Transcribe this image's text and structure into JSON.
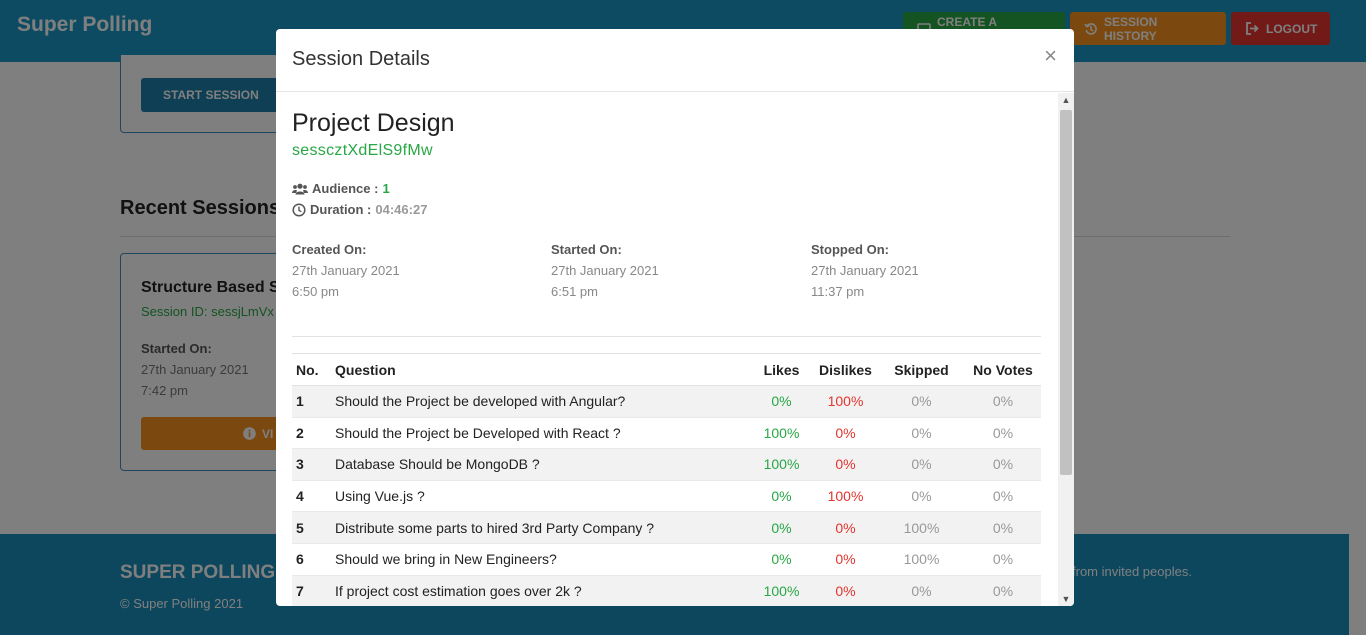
{
  "navbar": {
    "brand": "Super Polling",
    "create_label": "CREATE A SESSION",
    "history_label": "SESSION HISTORY",
    "logout_label": "LOGOUT"
  },
  "page": {
    "start_session_label": "START SESSION",
    "recent_sessions_title": "Recent Sessions",
    "session_card": {
      "title": "Structure Based S",
      "session_id": "Session ID: sessjLmVx",
      "started_label": "Started On:",
      "started_date": "27th January 2021",
      "started_time": "7:42 pm",
      "view_label": "VI"
    }
  },
  "footer": {
    "brand": "SUPER POLLING",
    "copyright": "© Super Polling 2021",
    "tagline": "from invited peoples."
  },
  "modal": {
    "title": "Session Details",
    "close": "×",
    "project_title": "Project Design",
    "session_code": "sesscztXdElS9fMw",
    "audience_label": "Audience :",
    "audience_value": "1",
    "duration_label": "Duration :",
    "duration_value": "04:46:27",
    "created": {
      "label": "Created On:",
      "date": "27th January 2021",
      "time": "6:50 pm"
    },
    "started": {
      "label": "Started On:",
      "date": "27th January 2021",
      "time": "6:51 pm"
    },
    "stopped": {
      "label": "Stopped On:",
      "date": "27th January 2021",
      "time": "11:37 pm"
    },
    "table": {
      "headers": {
        "no": "No.",
        "question": "Question",
        "likes": "Likes",
        "dislikes": "Dislikes",
        "skipped": "Skipped",
        "novotes": "No Votes"
      },
      "rows": [
        {
          "no": "1",
          "question": "Should the Project be developed with Angular?",
          "likes": "0%",
          "dislikes": "100%",
          "skipped": "0%",
          "novotes": "0%"
        },
        {
          "no": "2",
          "question": "Should the Project be Developed with React ?",
          "likes": "100%",
          "dislikes": "0%",
          "skipped": "0%",
          "novotes": "0%"
        },
        {
          "no": "3",
          "question": "Database Should be MongoDB ?",
          "likes": "100%",
          "dislikes": "0%",
          "skipped": "0%",
          "novotes": "0%"
        },
        {
          "no": "4",
          "question": "Using Vue.js ?",
          "likes": "0%",
          "dislikes": "100%",
          "skipped": "0%",
          "novotes": "0%"
        },
        {
          "no": "5",
          "question": "Distribute some parts to hired 3rd Party Company ?",
          "likes": "0%",
          "dislikes": "0%",
          "skipped": "100%",
          "novotes": "0%"
        },
        {
          "no": "6",
          "question": "Should we bring in New Engineers?",
          "likes": "0%",
          "dislikes": "0%",
          "skipped": "100%",
          "novotes": "0%"
        },
        {
          "no": "7",
          "question": "If project cost estimation goes over 2k ?",
          "likes": "100%",
          "dislikes": "0%",
          "skipped": "0%",
          "novotes": "0%"
        }
      ]
    }
  },
  "colors": {
    "navbar": "#1996c4",
    "green": "#28a745",
    "orange": "#f6921e",
    "red": "#e3342f"
  },
  "icons": [
    "monitor-icon",
    "history-icon",
    "logout-icon",
    "info-icon",
    "users-icon",
    "clock-icon",
    "close-icon",
    "scroll-up-icon",
    "scroll-down-icon"
  ]
}
